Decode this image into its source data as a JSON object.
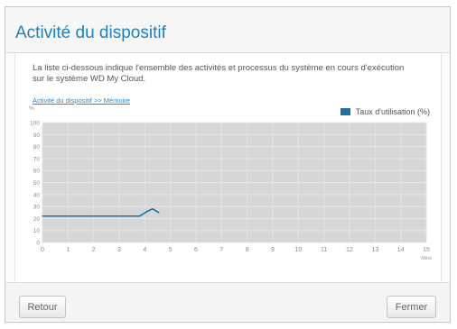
{
  "dialog": {
    "title": "Activité du dispositif",
    "description": "La liste ci-dessous indique l'ensemble des activités et processus du système en cours d'exécution sur le système WD My Cloud.",
    "breadcrumb_link": "Activité du dispositif >> Mémoire",
    "back_label": "Retour",
    "close_label": "Fermer"
  },
  "chart_data": {
    "type": "line",
    "yunit": "%",
    "xunit": "Mins",
    "xlim": [
      0,
      15
    ],
    "ylim": [
      0,
      100
    ],
    "xticks": [
      "0",
      "1",
      "2",
      "3",
      "4",
      "5",
      "6",
      "7",
      "8",
      "9",
      "10",
      "11",
      "12",
      "13",
      "14",
      "15"
    ],
    "yticks": [
      "0",
      "10",
      "20",
      "30",
      "40",
      "50",
      "60",
      "70",
      "80",
      "90",
      "100"
    ],
    "grid": true,
    "legend_position": "top-right",
    "series": [
      {
        "name": "Taux d'utilisation (%)",
        "color": "#1d6fa5",
        "x": [
          0,
          0.5,
          1,
          1.5,
          2,
          2.5,
          3,
          3.5,
          3.8,
          4.1,
          4.3,
          4.55
        ],
        "y": [
          22,
          22,
          22,
          22,
          22,
          22,
          22,
          22,
          22,
          26,
          28,
          25
        ]
      }
    ]
  }
}
